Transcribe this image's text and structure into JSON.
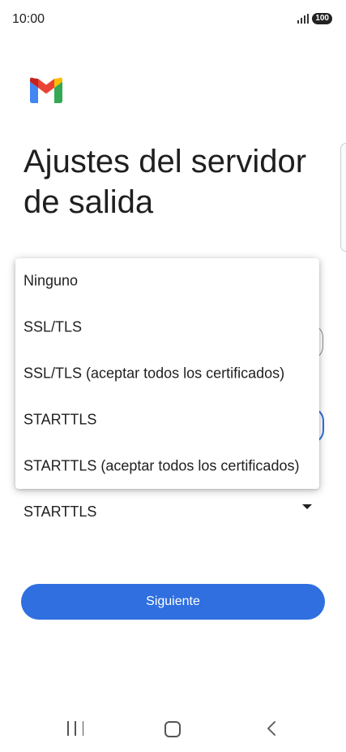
{
  "status_bar": {
    "time": "10:00",
    "battery": "100"
  },
  "icons": {
    "app_logo": "gmail-logo-icon",
    "signal": "signal-bars-icon",
    "caret": "caret-down-icon",
    "recents": "recents-icon",
    "home": "home-icon",
    "back": "back-icon"
  },
  "page": {
    "title": "Ajustes del servidor de salida"
  },
  "dropdown": {
    "options": [
      "Ninguno",
      "SSL/TLS",
      "SSL/TLS (aceptar todos los certificados)",
      "STARTTLS",
      "STARTTLS (aceptar todos los certificados)"
    ]
  },
  "security_field": {
    "value": "STARTTLS"
  },
  "actions": {
    "next_label": "Siguiente"
  },
  "colors": {
    "accent": "#2f6fdf",
    "gmail_blue": "#4285F4",
    "gmail_red": "#EA4335",
    "gmail_yellow": "#FBBC04",
    "gmail_green": "#34A853"
  }
}
